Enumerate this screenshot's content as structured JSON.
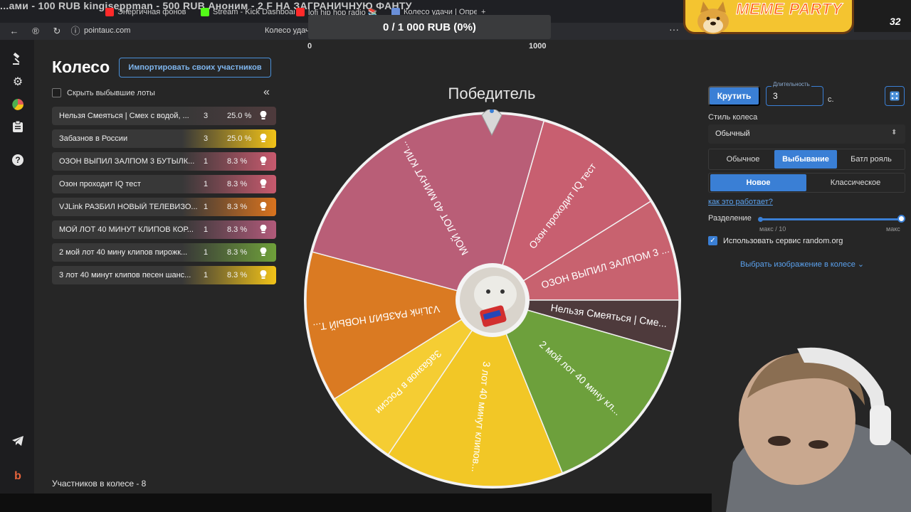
{
  "browser": {
    "overlay_ticker": "...ами - 100 RUB      kingiseppman - 500 RUB       Аноним - 2 F       НА ЗАГРАНИЧНУЮ ФАНТУ",
    "tabs": [
      {
        "label": "Энергичная фонов",
        "color": "#ff2a2a"
      },
      {
        "label": "Stream - Kick Dashboard",
        "color": "#53fc18"
      },
      {
        "label": "lofi hip hop radio 📚 beat",
        "color": "#ff2a2a"
      },
      {
        "label": "Колесо удачи | Опред",
        "color": "#6a8fd8"
      }
    ],
    "url": "pointauc.com",
    "address_title": "Колесо удачи"
  },
  "progress": {
    "text": "0 / 1 000 RUB (0%)",
    "min": "0",
    "max": "1000",
    "fraction": 0
  },
  "meme": {
    "title": "MEME PARTY",
    "count": "32"
  },
  "sidebar": {
    "icons": [
      "auction-hammer-icon",
      "gear-icon",
      "wheel-chart-icon",
      "clipboard-icon",
      "help-icon",
      "telegram-icon",
      "brand-icon"
    ]
  },
  "page": {
    "title": "Колесо",
    "import_button": "Импортировать своих участников",
    "hide_lots_label": "Скрыть выбывшие лоты",
    "participants": "Участников в колесе - 8"
  },
  "lots": [
    {
      "name": "Нельзя Смеяться | Смех с водой, ...",
      "count": "3",
      "percent": "25.0 %",
      "color": "#4e3a3c"
    },
    {
      "name": "Забазнов в России",
      "count": "3",
      "percent": "25.0 %",
      "color": "#f2c318"
    },
    {
      "name": "ОЗОН ВЫПИЛ ЗАЛПОМ 3 БУТЫЛК...",
      "count": "1",
      "percent": "8.3 %",
      "color": "#c85a6e"
    },
    {
      "name": "Озон проходит IQ тест",
      "count": "1",
      "percent": "8.3 %",
      "color": "#c85a6e"
    },
    {
      "name": "VJLink РАЗБИЛ НОВЫЙ ТЕЛЕВИЗО...",
      "count": "1",
      "percent": "8.3 %",
      "color": "#d9731e"
    },
    {
      "name": "МОЙ ЛОТ 40 МИНУТ КЛИПОВ КОР...",
      "count": "1",
      "percent": "8.3 %",
      "color": "#b15a7a"
    },
    {
      "name": "2 мой лот 40 мину клипов пирожк...",
      "count": "1",
      "percent": "8.3 %",
      "color": "#6fa03a"
    },
    {
      "name": "3 лот 40 минут клипов песен шанс...",
      "count": "1",
      "percent": "8.3 %",
      "color": "#f2c318"
    }
  ],
  "wheel": {
    "winner_label": "Победитель",
    "segments": [
      {
        "label": "Озон проходит IQ тест",
        "start": -74,
        "end": -32,
        "color": "#c85f70"
      },
      {
        "label": "ОЗОН ВЫПИЛ ЗАЛПОМ 3 ...",
        "start": -32,
        "end": 0,
        "color": "#c8626f"
      },
      {
        "label": "Нельзя Смеяться | Сме...",
        "start": 0,
        "end": 16,
        "color": "#4e3a3c"
      },
      {
        "label": "2 мой лот 40 мину кл...",
        "start": 16,
        "end": 68,
        "color": "#6da03c"
      },
      {
        "label": "3 лот 40 минут клипов...",
        "start": 68,
        "end": 124,
        "color": "#f2c726"
      },
      {
        "label": "Забазнов в России",
        "start": 124,
        "end": 148,
        "color": "#f5cd33"
      },
      {
        "label": "VJLink РАЗБИЛ НОВЫЙ Т...",
        "start": 148,
        "end": 195,
        "color": "#da7a22"
      },
      {
        "label": "МОЙ ЛОТ 40 МИНУТ КЛИ...",
        "start": 195,
        "end": 286,
        "color": "#b95e77"
      }
    ]
  },
  "controls": {
    "spin_button": "Крутить",
    "duration_label": "Длительность",
    "duration_value": "3",
    "duration_unit": "с.",
    "wheel_style_label": "Стиль колеса",
    "wheel_style_value": "Обычный",
    "modes": [
      "Обычное",
      "Выбывание",
      "Батл рояль"
    ],
    "active_mode": "Выбывание",
    "sub_modes": [
      "Новое",
      "Классическое"
    ],
    "active_sub_mode": "Новое",
    "how_link": "как это работает?",
    "split_label": "Разделение",
    "split_min": "макс / 10",
    "split_max": "макс",
    "split_fraction": 1,
    "random_org_label": "Использовать сервис random.org",
    "random_org_checked": true,
    "image_select": "Выбрать изображение в колесе"
  },
  "colors": {
    "accent": "#3a7fd5",
    "background": "#262626",
    "sidebar": "#1d1d1f"
  }
}
